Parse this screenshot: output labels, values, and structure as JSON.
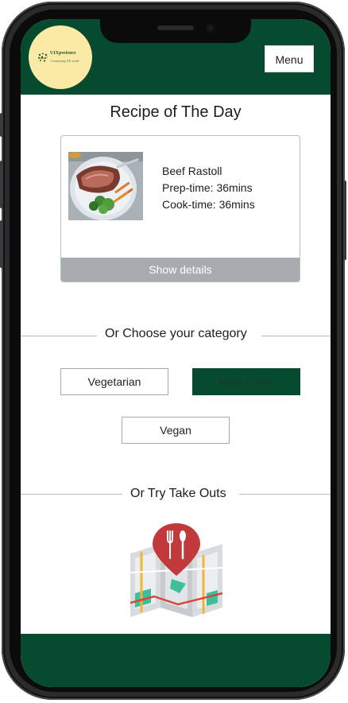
{
  "header": {
    "logo_title": "UIXperience",
    "logo_tagline": "Connecting UX world",
    "menu_label": "Menu"
  },
  "recipe_of_day": {
    "title": "Recipe of The Day",
    "name": "Beef Rastoll",
    "prep_time": "Prep-time: 36mins",
    "cook_time": "Cook-time: 36mins",
    "details_label": "Show details"
  },
  "categories": {
    "heading": "Or Choose your category",
    "items": [
      "Vegetarian",
      "Meat Lover",
      "Vegan"
    ],
    "selected": "Meat Lover"
  },
  "takeouts": {
    "heading": "Or Try Take Outs"
  },
  "colors": {
    "brand_green": "#064a2f",
    "logo_bg": "#fbeaa5",
    "button_gray": "#a6abb0",
    "map_pin_red": "#c2393b"
  }
}
